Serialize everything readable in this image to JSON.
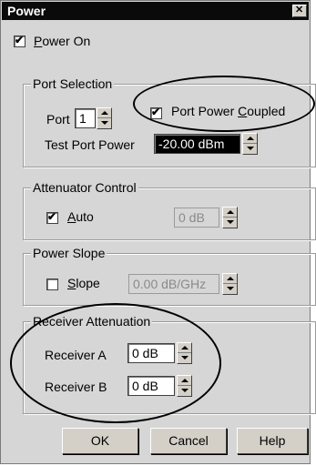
{
  "window": {
    "title": "Power"
  },
  "power_on": {
    "label_prefix": "",
    "accel": "P",
    "label_rest": "ower On",
    "checked": true
  },
  "port_selection": {
    "legend": "Port Selection",
    "port_label": "Port",
    "port_value": "1",
    "coupled_prefix": "Port Power ",
    "coupled_accel": "C",
    "coupled_rest": "oupled",
    "coupled_checked": true,
    "test_port_power_label": "Test Port Power",
    "test_port_power_value": "-20.00 dBm"
  },
  "attenuator_control": {
    "legend": "Attenuator Control",
    "auto_accel": "A",
    "auto_rest": "uto",
    "auto_checked": true,
    "value": "0 dB"
  },
  "power_slope": {
    "legend": "Power Slope",
    "slope_accel": "S",
    "slope_rest": "lope",
    "slope_checked": false,
    "value": "0.00 dB/GHz"
  },
  "receiver_attenuation": {
    "legend": "Receiver Attenuation",
    "receiver_a_label": "Receiver A",
    "receiver_a_value": "0 dB",
    "receiver_b_label": "Receiver B",
    "receiver_b_value": "0 dB"
  },
  "buttons": {
    "ok": "OK",
    "cancel": "Cancel",
    "help": "Help"
  }
}
